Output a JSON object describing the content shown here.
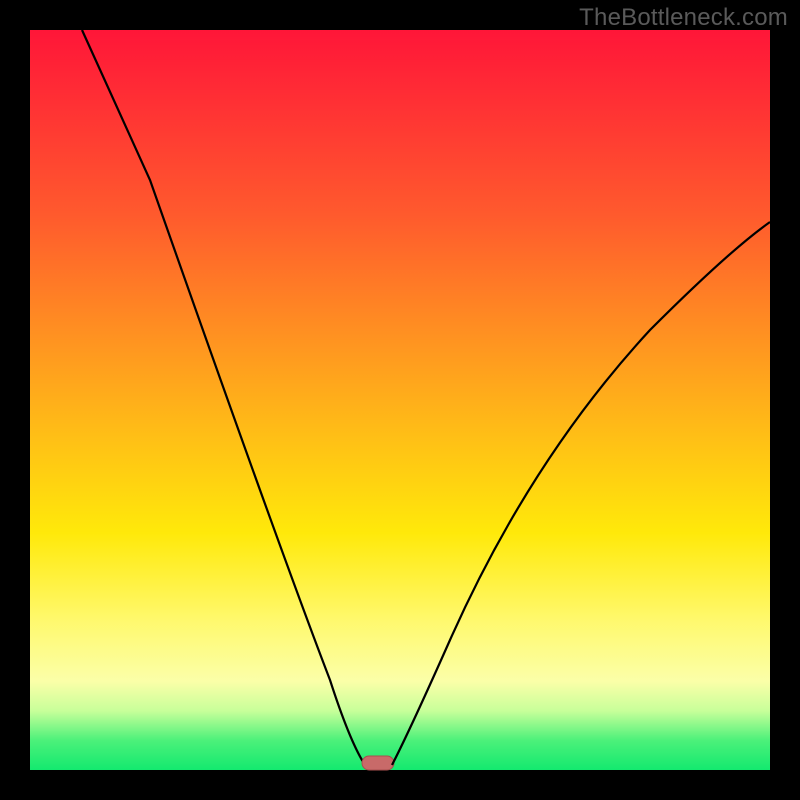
{
  "watermark": "TheBottleneck.com",
  "colors": {
    "frame": "#000000",
    "curve": "#000000",
    "pill_fill": "#c86a69",
    "pill_stroke": "#a84f4e",
    "gradient_top": "#ff1638",
    "gradient_bottom": "#13e96f"
  },
  "chart_data": {
    "type": "line",
    "title": "",
    "xlabel": "",
    "ylabel": "",
    "xlim": [
      0,
      100
    ],
    "ylim": [
      0,
      100
    ],
    "series": [
      {
        "name": "left-branch",
        "x": [
          7,
          10,
          14,
          18,
          22,
          26,
          30,
          34,
          37,
          40,
          42,
          44,
          45.5
        ],
        "y": [
          100,
          91,
          79,
          68,
          57,
          46,
          36,
          26,
          18,
          11,
          6,
          2,
          0
        ]
      },
      {
        "name": "right-branch",
        "x": [
          49,
          52,
          56,
          60,
          65,
          70,
          75,
          80,
          85,
          90,
          95,
          100
        ],
        "y": [
          0,
          5,
          12,
          20,
          29,
          38,
          46,
          53,
          60,
          65,
          70,
          74
        ]
      }
    ],
    "marker": {
      "name": "min-pill",
      "x": 47,
      "y": 0,
      "width": 4,
      "height": 2
    },
    "notes": "V-shaped bottleneck curve on red→green vertical gradient; minimum near x≈47% at y≈0. Axis values are approximate, read from the figure which has no numeric ticks."
  }
}
